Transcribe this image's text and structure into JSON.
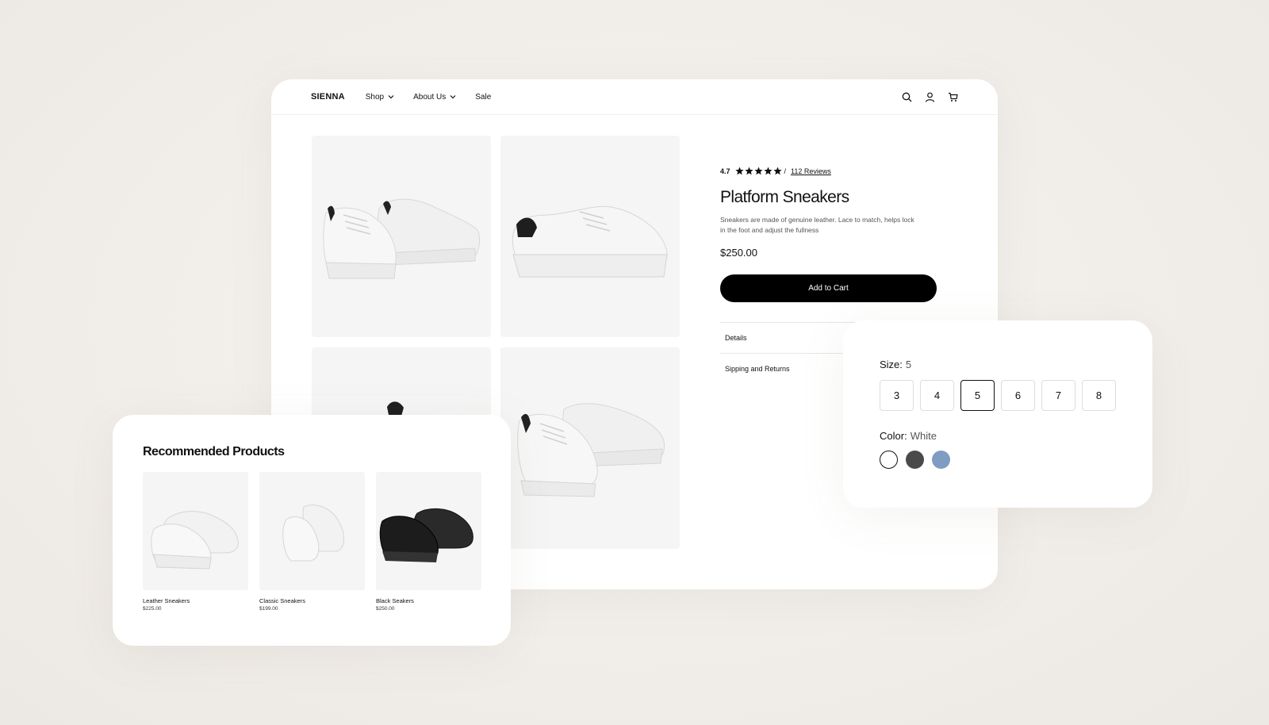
{
  "nav": {
    "logo": "SIENNA",
    "items": [
      {
        "label": "Shop",
        "has_dropdown": true
      },
      {
        "label": "About Us",
        "has_dropdown": true
      },
      {
        "label": "Sale",
        "has_dropdown": false
      }
    ],
    "icons": [
      "search-icon",
      "user-icon",
      "cart-icon"
    ]
  },
  "product": {
    "rating": "4.7",
    "stars": 5,
    "rating_separator": "/",
    "reviews_label": "112 Reviews",
    "title": "Platform Sneakers",
    "description": "Sneakers are made of genuine leather. Lace to match, helps lock in the foot and adjust the fullness",
    "price": "$250.00",
    "add_to_cart_label": "Add to Cart",
    "accordion": [
      {
        "label": "Details"
      },
      {
        "label": "Sipping and Returns"
      }
    ]
  },
  "variants": {
    "size_label": "Size:",
    "selected_size": "5",
    "sizes": [
      "3",
      "4",
      "5",
      "6",
      "7",
      "8"
    ],
    "color_label": "Color:",
    "selected_color": "White",
    "colors": [
      {
        "name": "White",
        "hex": "#ffffff",
        "selected": true
      },
      {
        "name": "Charcoal",
        "hex": "#4a4a4a",
        "selected": false
      },
      {
        "name": "Blue",
        "hex": "#7f9cc2",
        "selected": false
      }
    ]
  },
  "recommended": {
    "title": "Recommended Products",
    "items": [
      {
        "name": "Leather Sneakers",
        "price": "$225.00"
      },
      {
        "name": "Classic Sneakers",
        "price": "$199.00"
      },
      {
        "name": "Black Seakers",
        "price": "$250.00"
      }
    ]
  },
  "colors": {
    "accent": "#000000",
    "tile_bg": "#f5f5f5",
    "page_bg": "#f1eeea"
  }
}
